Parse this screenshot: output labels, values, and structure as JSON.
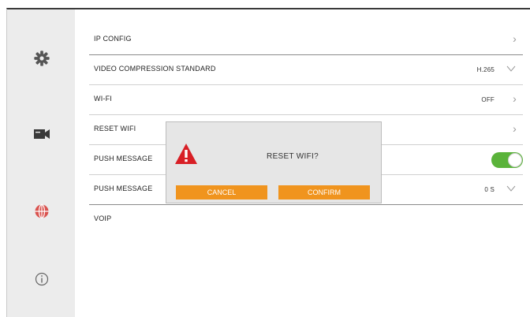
{
  "sidebar": {
    "items": [
      {
        "icon": "gear-icon"
      },
      {
        "icon": "camera-icon"
      },
      {
        "icon": "network-globe-icon",
        "active": true
      },
      {
        "icon": "info-icon"
      }
    ],
    "active_color": "#d9534f"
  },
  "settings": {
    "ip_config": {
      "label": "IP CONFIG"
    },
    "video_compression": {
      "label": "VIDEO COMPRESSION STANDARD",
      "value": "H.265"
    },
    "wifi": {
      "label": "WI-FI",
      "value": "OFF"
    },
    "reset_wifi": {
      "label": "RESET WIFI"
    },
    "push_message": {
      "label": "PUSH MESSAGE",
      "toggle_on": true
    },
    "push_message_interval": {
      "label": "PUSH MESSAGE",
      "value": "0 S"
    },
    "voip": {
      "label": "VOIP"
    }
  },
  "dialog": {
    "message": "RESET WIFI?",
    "cancel_label": "CANCEL",
    "confirm_label": "CONFIRM",
    "accent_color": "#f0941e"
  }
}
